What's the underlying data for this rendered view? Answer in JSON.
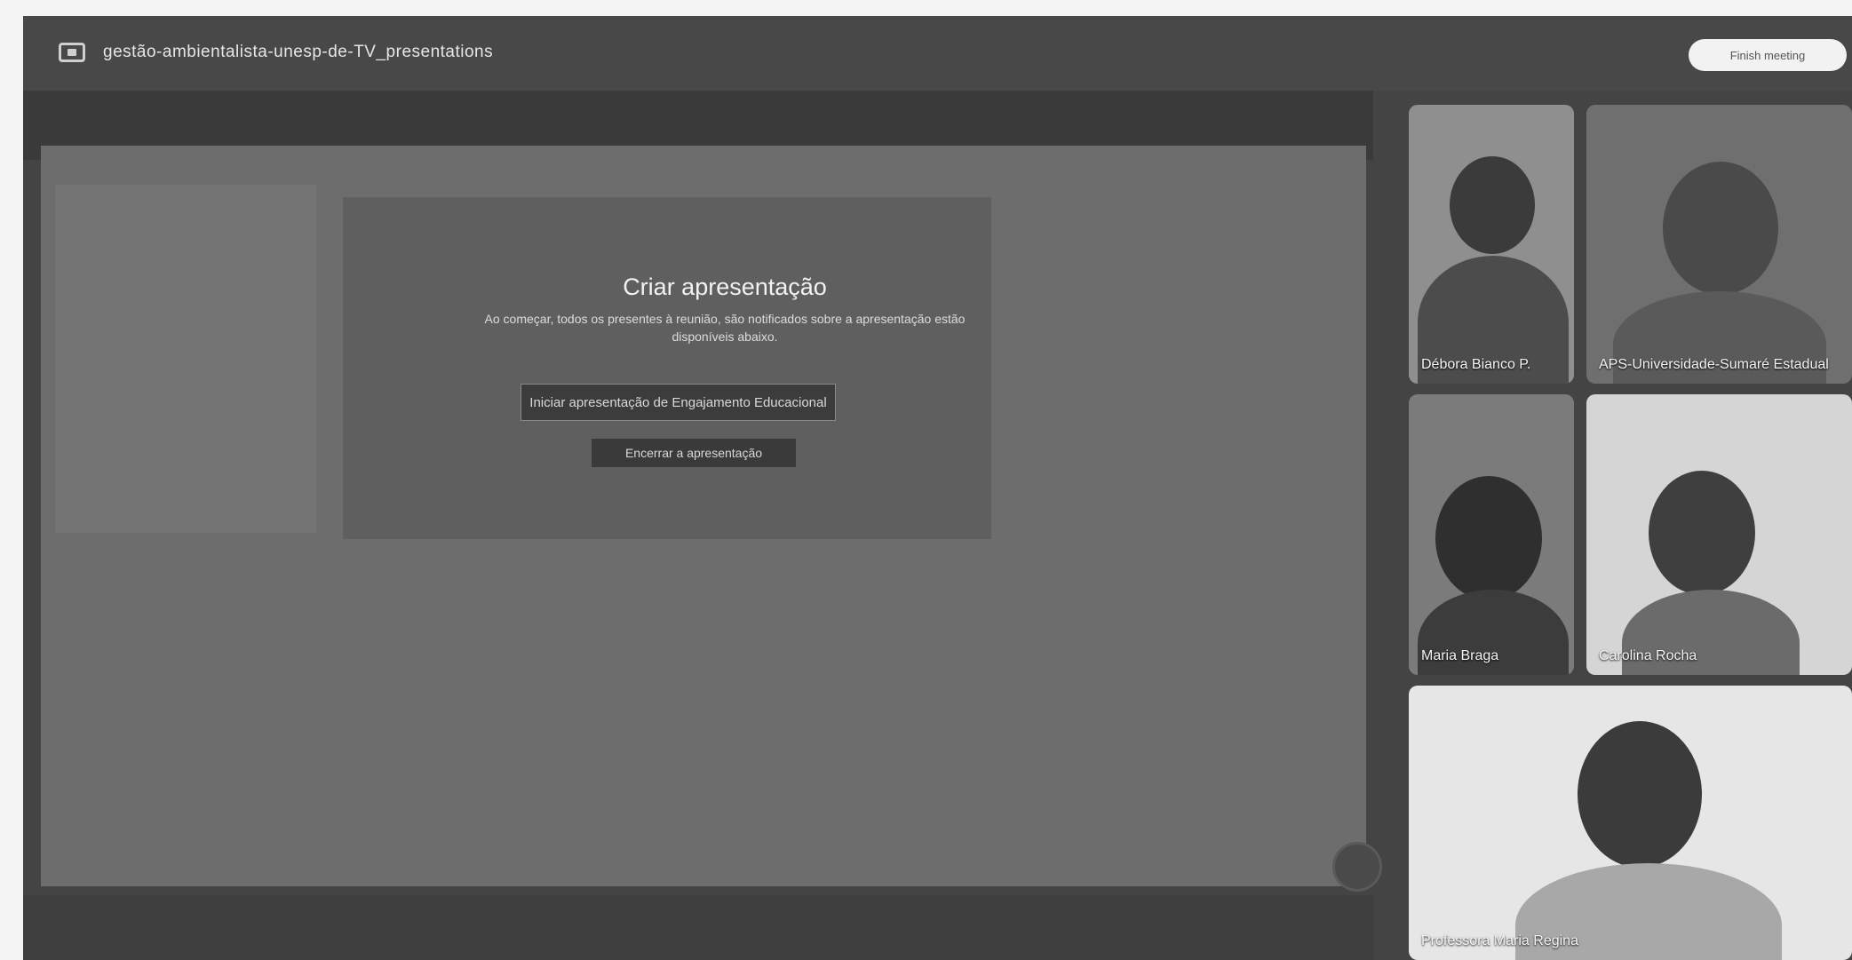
{
  "window": {
    "title": "gestão-ambientalista-unesp-de-TV_presentations",
    "top_button_label": "Finish meeting"
  },
  "presentation": {
    "dialog_title": "Criar apresentação",
    "dialog_description": "Ao começar, todos os presentes à reunião, são notificados sobre a apresentação estão disponíveis abaixo.",
    "share_button_label": "Iniciar apresentação de Engajamento Educacional",
    "stop_button_label": "Encerrar a apresentação"
  },
  "participants": [
    {
      "name": "Débora Bianco P."
    },
    {
      "name": "APS-Universidade-Sumaré Estadual"
    },
    {
      "name": "Maria Braga"
    },
    {
      "name": "Carolina Rocha"
    },
    {
      "name": "Professora Maria Regina"
    }
  ]
}
